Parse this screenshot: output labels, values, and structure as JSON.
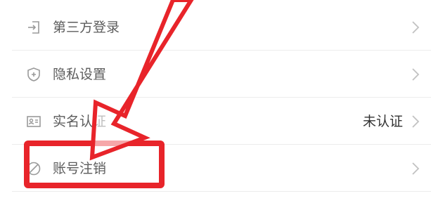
{
  "settings_list": {
    "items": [
      {
        "label": "第三方登录",
        "value": "",
        "icon": "login-arrow-icon"
      },
      {
        "label": "隐私设置",
        "value": "",
        "icon": "shield-plus-icon"
      },
      {
        "label": "实名认证",
        "value": "未认证",
        "icon": "id-card-icon"
      },
      {
        "label": "账号注销",
        "value": "",
        "icon": "slash-circle-icon"
      }
    ]
  },
  "annotation": {
    "arrow_color": "#e8242a",
    "highlight_color": "#e8242a"
  },
  "colors": {
    "label": "#5c5c5c",
    "icon": "#9a9a9a",
    "divider": "#ececec",
    "chevron": "#c2c2c2"
  }
}
